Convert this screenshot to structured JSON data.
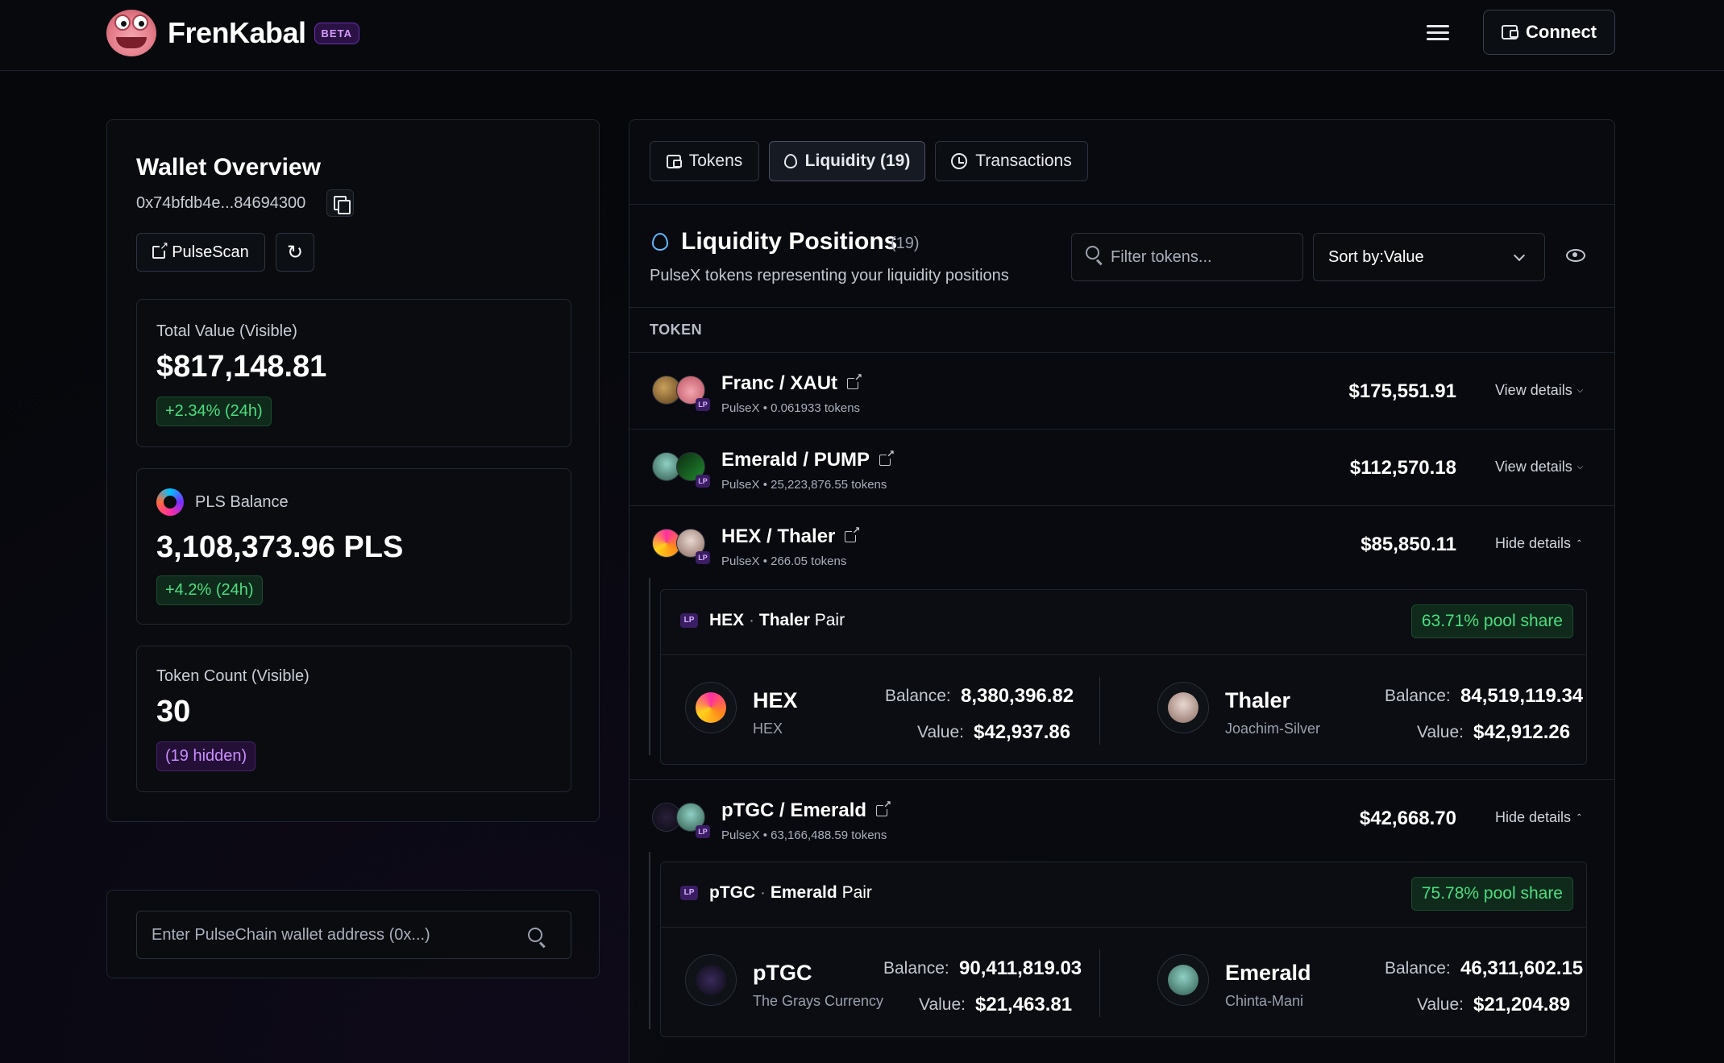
{
  "header": {
    "brand": "FrenKabal",
    "beta": "BETA",
    "connect_label": "Connect"
  },
  "wallet": {
    "title": "Wallet Overview",
    "address": "0x74bfdb4e...84694300",
    "pulsescan_label": "PulseScan",
    "total_label": "Total Value (Visible)",
    "total_value": "$817,148.81",
    "total_change": "+2.34% (24h)",
    "pls_label": "PLS Balance",
    "pls_value": "3,108,373.96 PLS",
    "pls_change": "+4.2% (24h)",
    "count_label": "Token Count (Visible)",
    "count_value": "30",
    "count_hidden": "(19 hidden)"
  },
  "search": {
    "placeholder": "Enter PulseChain wallet address (0x...)"
  },
  "tabs": [
    {
      "label": "Tokens"
    },
    {
      "label": "Liquidity (19)"
    },
    {
      "label": "Transactions"
    }
  ],
  "liquidity": {
    "title": "Liquidity Positions",
    "count": "(19)",
    "subtitle": "PulseX tokens representing your liquidity positions",
    "filter_placeholder": "Filter tokens...",
    "sort_label": "Sort by:Value",
    "col_token": "TOKEN",
    "lp_badge": "LP",
    "pair_word": "Pair",
    "balance_label": "Balance:",
    "value_label": "Value:"
  },
  "positions": [
    {
      "name": "Franc / XAUt",
      "sub": "PulseX • 0.061933 tokens",
      "value": "$175,551.91",
      "action": "View details"
    },
    {
      "name": "Emerald / PUMP",
      "sub": "PulseX • 25,223,876.55 tokens",
      "value": "$112,570.18",
      "action": "View details"
    },
    {
      "name": "HEX / Thaler",
      "sub": "PulseX • 266.05 tokens",
      "value": "$85,850.11",
      "action": "Hide details",
      "detail": {
        "token0": "HEX",
        "token1": "Thaler",
        "share": "63.71% pool share",
        "t0_name": "HEX",
        "t0_sub": "HEX",
        "t0_balance": "8,380,396.82",
        "t0_value": "$42,937.86",
        "t1_name": "Thaler",
        "t1_sub": "Joachim-Silver",
        "t1_balance": "84,519,119.34",
        "t1_value": "$42,912.26"
      }
    },
    {
      "name": "pTGC / Emerald",
      "sub": "PulseX • 63,166,488.59 tokens",
      "value": "$42,668.70",
      "action": "Hide details",
      "detail": {
        "token0": "pTGC",
        "token1": "Emerald",
        "share": "75.78% pool share",
        "t0_name": "pTGC",
        "t0_sub": "The Grays Currency",
        "t0_balance": "90,411,819.03",
        "t0_value": "$21,463.81",
        "t1_name": "Emerald",
        "t1_sub": "Chinta-Mani",
        "t1_balance": "46,311,602.15",
        "t1_value": "$21,204.89"
      }
    }
  ],
  "colors": {
    "accent_green": "#4ade80",
    "accent_purple": "#c98cff",
    "background": "#05070a"
  },
  "icons": [
    "wallet-icon",
    "copy-icon",
    "external-link-icon",
    "refresh-icon",
    "search-icon",
    "droplet-icon",
    "clock-icon",
    "eye-icon",
    "chevron-down-icon",
    "menu-icon"
  ]
}
